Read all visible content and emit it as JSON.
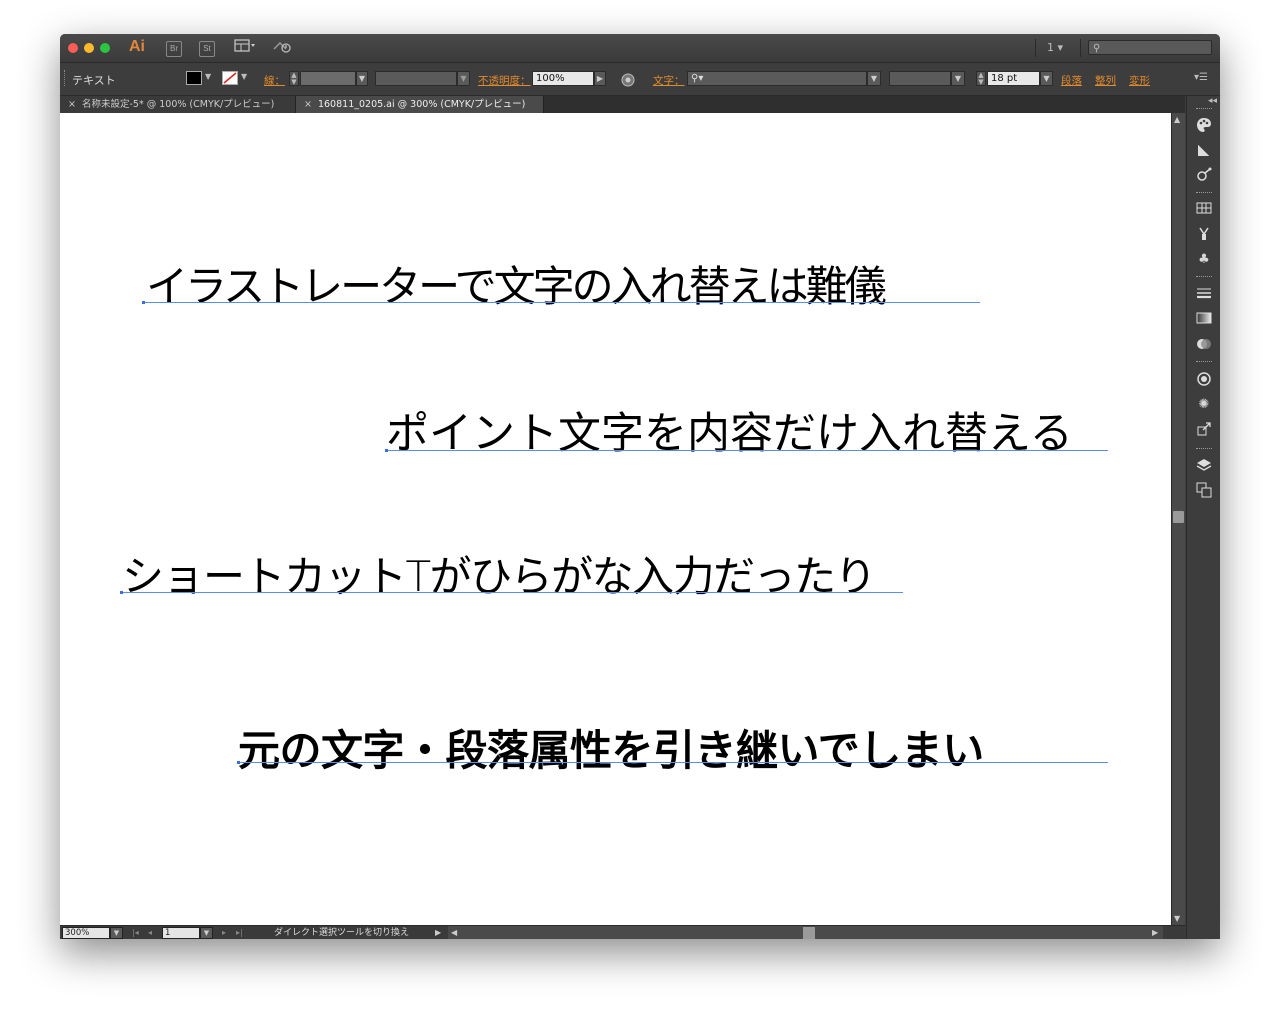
{
  "app": {
    "logo": "Ai",
    "bridge_label": "Br",
    "stock_label": "St",
    "page_indicator": "1",
    "search_placeholder": ""
  },
  "controlbar": {
    "tool_name": "テキスト",
    "stroke_label": "線：",
    "opacity_label": "不透明度：",
    "opacity_value": "100%",
    "character_label": "文字：",
    "font_size_value": "18 pt",
    "paragraph_link": "段落",
    "align_link": "整列",
    "transform_link": "変形"
  },
  "tabs": [
    {
      "label": "名称未設定-5* @ 100% (CMYK/プレビュー)",
      "active": false
    },
    {
      "label": "160811_0205.ai @ 300% (CMYK/プレビュー)",
      "active": true
    }
  ],
  "canvas": {
    "lines": [
      "イラストレーターで文字の入れ替えは難儀",
      "ポイント文字を内容だけ入れ替える",
      "ショートカットTがひらがな入力だったり",
      "元の文字・段落属性を引き継いでしまい"
    ]
  },
  "statusbar": {
    "zoom_value": "300%",
    "artboard_value": "1",
    "status_text": "ダイレクト選択ツールを切り換え"
  },
  "colors": {
    "accent_orange": "#e38a2d",
    "baseline_blue": "#5b8cf0",
    "ui_dark": "#3d3d3d"
  },
  "icons": [
    "arrange-icon",
    "gpu-icon",
    "search-icon",
    "recolor-icon",
    "color-panel-icon",
    "color-guide-icon",
    "cc-libraries-icon",
    "swatches-icon",
    "brushes-icon",
    "symbols-icon",
    "stroke-icon",
    "gradient-icon",
    "transparency-icon",
    "appearance-icon",
    "graphic-styles-icon",
    "asset-export-icon",
    "layers-icon",
    "artboards-icon"
  ]
}
